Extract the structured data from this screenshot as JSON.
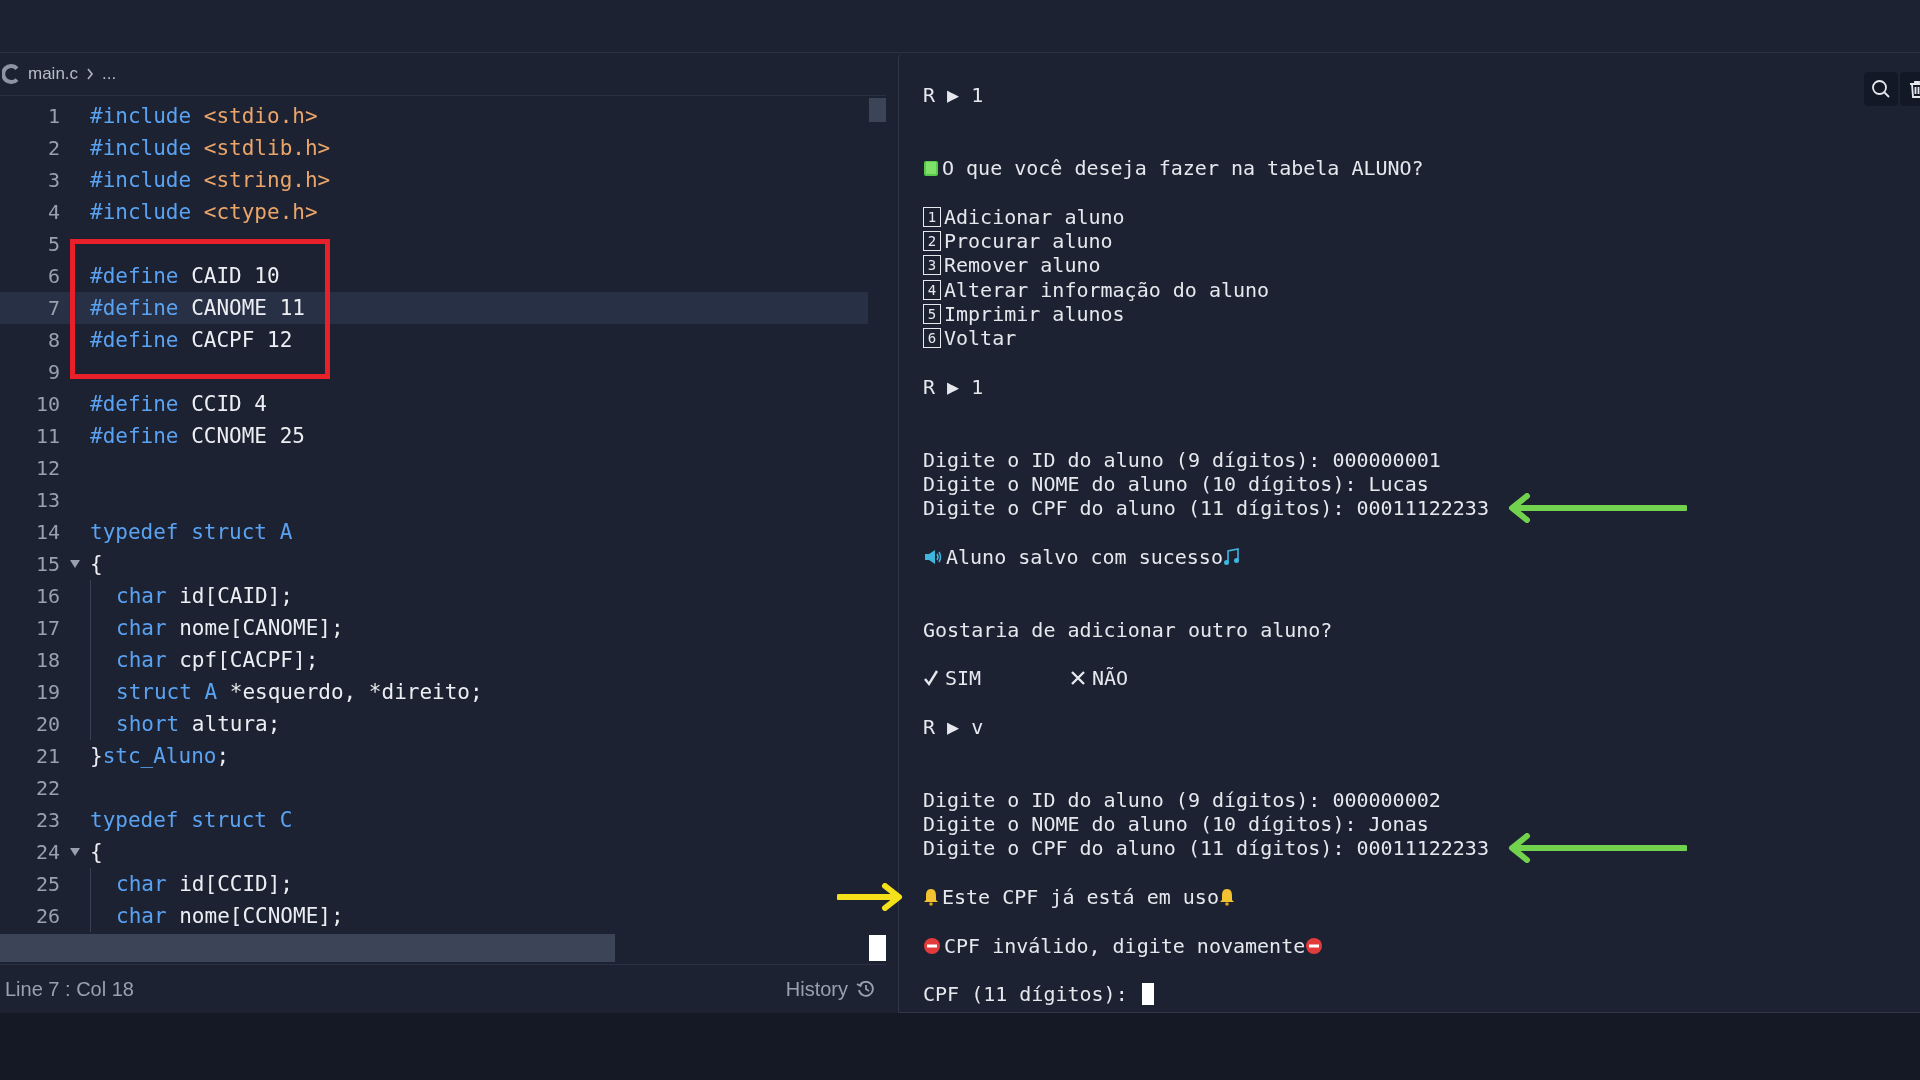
{
  "editor": {
    "breadcrumb": {
      "file": "main.c",
      "more": "..."
    },
    "lines": [
      {
        "num": "1",
        "current": false,
        "boxed": false,
        "foldable": false,
        "indent": false,
        "tokens": [
          {
            "kind": "kw",
            "text": "#include"
          },
          {
            "kind": "str",
            "text": " <stdio.h>"
          }
        ]
      },
      {
        "num": "2",
        "current": false,
        "boxed": false,
        "foldable": false,
        "indent": false,
        "tokens": [
          {
            "kind": "kw",
            "text": "#include"
          },
          {
            "kind": "str",
            "text": " <stdlib.h>"
          }
        ]
      },
      {
        "num": "3",
        "current": false,
        "boxed": false,
        "foldable": false,
        "indent": false,
        "tokens": [
          {
            "kind": "kw",
            "text": "#include"
          },
          {
            "kind": "str",
            "text": " <string.h>"
          }
        ]
      },
      {
        "num": "4",
        "current": false,
        "boxed": false,
        "foldable": false,
        "indent": false,
        "tokens": [
          {
            "kind": "kw",
            "text": "#include"
          },
          {
            "kind": "str",
            "text": " <ctype.h>"
          }
        ]
      },
      {
        "num": "5",
        "current": false,
        "boxed": false,
        "foldable": false,
        "indent": false
      },
      {
        "num": "6",
        "current": false,
        "boxed": true,
        "foldable": false,
        "indent": false,
        "tokens": [
          {
            "kind": "kw",
            "text": "#define"
          },
          {
            "kind": "plain",
            "text": " CAID 10"
          }
        ]
      },
      {
        "num": "7",
        "current": true,
        "boxed": true,
        "foldable": false,
        "indent": false,
        "tokens": [
          {
            "kind": "kw",
            "text": "#define"
          },
          {
            "kind": "plain",
            "text": " CANOME 11"
          }
        ]
      },
      {
        "num": "8",
        "current": false,
        "boxed": true,
        "foldable": false,
        "indent": false,
        "tokens": [
          {
            "kind": "kw",
            "text": "#define"
          },
          {
            "kind": "plain",
            "text": " CACPF 12"
          }
        ]
      },
      {
        "num": "9",
        "current": false,
        "boxed": false,
        "foldable": false,
        "indent": false
      },
      {
        "num": "10",
        "current": false,
        "boxed": false,
        "foldable": false,
        "indent": false,
        "tokens": [
          {
            "kind": "kw",
            "text": "#define"
          },
          {
            "kind": "plain",
            "text": " CCID 4"
          }
        ]
      },
      {
        "num": "11",
        "current": false,
        "boxed": false,
        "foldable": false,
        "indent": false,
        "tokens": [
          {
            "kind": "kw",
            "text": "#define"
          },
          {
            "kind": "plain",
            "text": " CCNOME 25"
          }
        ]
      },
      {
        "num": "12",
        "current": false,
        "boxed": false,
        "foldable": false,
        "indent": false
      },
      {
        "num": "13",
        "current": false,
        "boxed": false,
        "foldable": false,
        "indent": false
      },
      {
        "num": "14",
        "current": false,
        "boxed": false,
        "foldable": false,
        "indent": false,
        "tokens": [
          {
            "kind": "kw",
            "text": "typedef struct A"
          }
        ]
      },
      {
        "num": "15",
        "current": false,
        "boxed": false,
        "foldable": true,
        "indent": false,
        "tokens": [
          {
            "kind": "plain",
            "text": "{"
          }
        ]
      },
      {
        "num": "16",
        "current": false,
        "boxed": false,
        "foldable": false,
        "indent": true,
        "tokens": [
          {
            "kind": "kw",
            "text": "char"
          },
          {
            "kind": "plain",
            "text": " id[CAID];"
          }
        ]
      },
      {
        "num": "17",
        "current": false,
        "boxed": false,
        "foldable": false,
        "indent": true,
        "tokens": [
          {
            "kind": "kw",
            "text": "char"
          },
          {
            "kind": "plain",
            "text": " nome[CANOME];"
          }
        ]
      },
      {
        "num": "18",
        "current": false,
        "boxed": false,
        "foldable": false,
        "indent": true,
        "tokens": [
          {
            "kind": "kw",
            "text": "char"
          },
          {
            "kind": "plain",
            "text": " cpf[CACPF];"
          }
        ]
      },
      {
        "num": "19",
        "current": false,
        "boxed": false,
        "foldable": false,
        "indent": true,
        "tokens": [
          {
            "kind": "kw",
            "text": "struct A"
          },
          {
            "kind": "plain",
            "text": " *esquerdo, *direito;"
          }
        ]
      },
      {
        "num": "20",
        "current": false,
        "boxed": false,
        "foldable": false,
        "indent": true,
        "tokens": [
          {
            "kind": "kw",
            "text": "short"
          },
          {
            "kind": "plain",
            "text": " altura;"
          }
        ]
      },
      {
        "num": "21",
        "current": false,
        "boxed": false,
        "foldable": false,
        "indent": false,
        "tokens": [
          {
            "kind": "plain",
            "text": "}"
          },
          {
            "kind": "kw",
            "text": "stc_Aluno"
          },
          {
            "kind": "plain",
            "text": ";"
          }
        ]
      },
      {
        "num": "22",
        "current": false,
        "boxed": false,
        "foldable": false,
        "indent": false
      },
      {
        "num": "23",
        "current": false,
        "boxed": false,
        "foldable": false,
        "indent": false,
        "tokens": [
          {
            "kind": "kw",
            "text": "typedef struct C"
          }
        ]
      },
      {
        "num": "24",
        "current": false,
        "boxed": false,
        "foldable": true,
        "indent": false,
        "tokens": [
          {
            "kind": "plain",
            "text": "{"
          }
        ]
      },
      {
        "num": "25",
        "current": false,
        "boxed": false,
        "foldable": false,
        "indent": true,
        "tokens": [
          {
            "kind": "kw",
            "text": "char"
          },
          {
            "kind": "plain",
            "text": " id[CCID];"
          }
        ]
      },
      {
        "num": "26",
        "current": false,
        "boxed": false,
        "foldable": false,
        "indent": true,
        "tokens": [
          {
            "kind": "kw",
            "text": "char"
          },
          {
            "kind": "plain",
            "text": " nome[CCNOME];"
          }
        ]
      }
    ],
    "status": {
      "position": "Line 7 : Col 18",
      "history": "History"
    }
  },
  "terminal": {
    "lines": [
      {
        "kind": "text",
        "text": "R ▶ 1"
      },
      {
        "kind": "blank"
      },
      {
        "kind": "blank"
      },
      {
        "kind": "heading",
        "text": "O que você deseja fazer na tabela ALUNO?"
      },
      {
        "kind": "blank"
      },
      {
        "kind": "option",
        "number": "1",
        "text": "Adicionar aluno"
      },
      {
        "kind": "option",
        "number": "2",
        "text": "Procurar aluno"
      },
      {
        "kind": "option",
        "number": "3",
        "text": "Remover aluno"
      },
      {
        "kind": "option",
        "number": "4",
        "text": "Alterar informação do aluno"
      },
      {
        "kind": "option",
        "number": "5",
        "text": "Imprimir alunos"
      },
      {
        "kind": "option",
        "number": "6",
        "text": "Voltar"
      },
      {
        "kind": "blank"
      },
      {
        "kind": "text",
        "text": "R ▶ 1"
      },
      {
        "kind": "blank"
      },
      {
        "kind": "blank"
      },
      {
        "kind": "text",
        "text": "Digite o ID do aluno (9 dígitos): 000000001"
      },
      {
        "kind": "text",
        "text": "Digite o NOME do aluno (10 dígitos): Lucas"
      },
      {
        "kind": "text",
        "text": "Digite o CPF do aluno (11 dígitos): 00011122233",
        "arrow": {
          "kind": "left",
          "color": "#72d24e"
        }
      },
      {
        "kind": "blank"
      },
      {
        "kind": "success",
        "text": "Aluno salvo com sucesso"
      },
      {
        "kind": "blank"
      },
      {
        "kind": "blank"
      },
      {
        "kind": "text",
        "text": "Gostaria de adicionar outro aluno?"
      },
      {
        "kind": "blank"
      },
      {
        "kind": "choices",
        "choices": [
          {
            "kind": "check",
            "label": "SIM"
          },
          {
            "kind": "cross",
            "label": "NÃO"
          }
        ]
      },
      {
        "kind": "blank"
      },
      {
        "kind": "text",
        "text": "R ▶ v"
      },
      {
        "kind": "blank"
      },
      {
        "kind": "blank"
      },
      {
        "kind": "text",
        "text": "Digite o ID do aluno (9 dígitos): 000000002"
      },
      {
        "kind": "text",
        "text": "Digite o NOME do aluno (10 dígitos): Jonas"
      },
      {
        "kind": "text",
        "text": "Digite o CPF do aluno (11 dígitos): 00011122233",
        "arrow": {
          "kind": "left",
          "color": "#72d24e"
        }
      },
      {
        "kind": "blank"
      },
      {
        "kind": "warning",
        "text": "Este CPF já está em uso",
        "arrow": {
          "kind": "right",
          "color": "#f5e11a"
        }
      },
      {
        "kind": "blank"
      },
      {
        "kind": "error",
        "text": "CPF inválido, digite novamente"
      },
      {
        "kind": "blank"
      },
      {
        "kind": "input",
        "text": "CPF (11 dígitos):"
      }
    ]
  }
}
